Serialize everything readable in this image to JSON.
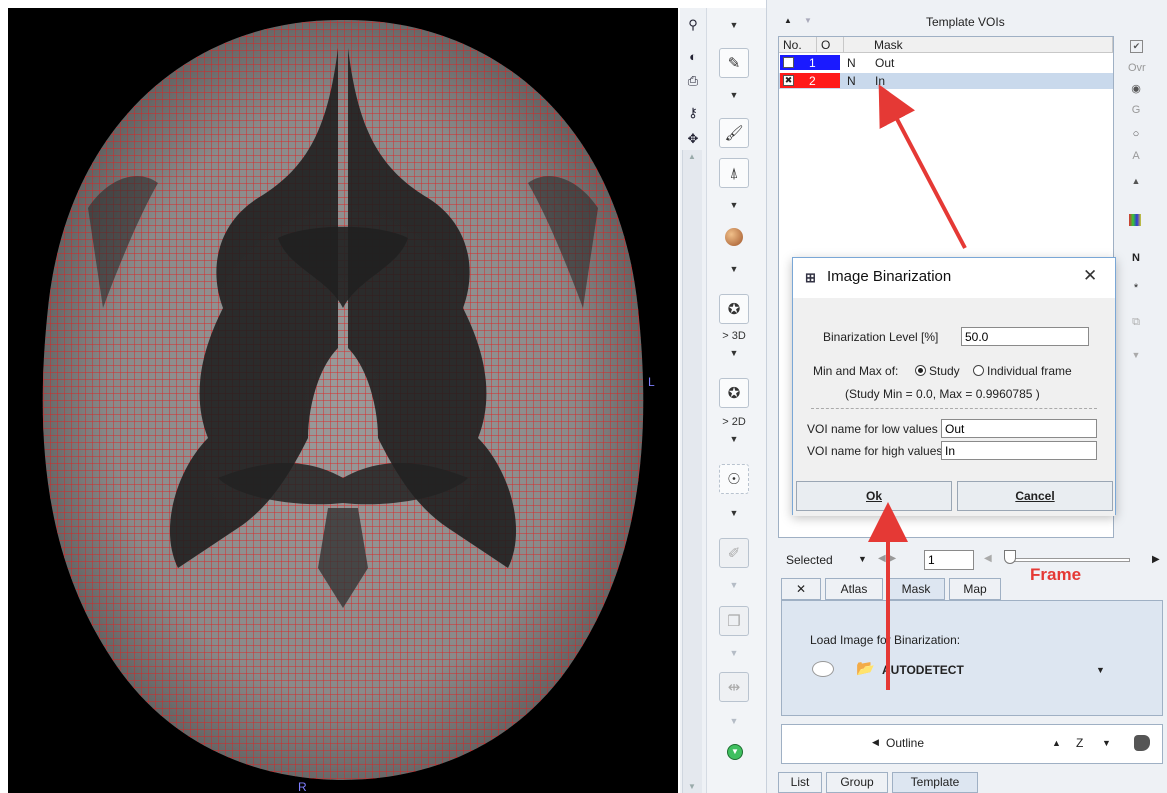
{
  "viewport": {
    "orientation_right": "L",
    "orientation_bottom": "R"
  },
  "toolbar": {
    "label_3d": "> 3D",
    "label_2d": "> 2D"
  },
  "voi_panel": {
    "header": "Template VOIs",
    "columns": [
      "No.",
      "O",
      "Mask"
    ],
    "rows": [
      {
        "no": "1",
        "o": "N",
        "name": "Out",
        "color": "#1a1aff",
        "selected": false
      },
      {
        "no": "2",
        "o": "N",
        "name": "In",
        "color": "#ff1a1a",
        "selected": true
      }
    ],
    "side_labels": {
      "ovr": "Ovr",
      "g": "G",
      "a": "A",
      "n": "N",
      "star": "*"
    }
  },
  "dialog": {
    "title": "Image Binarization",
    "close": "✕",
    "level_label": "Binarization Level [%]",
    "level_value": "50.0",
    "minmax_label": "Min and Max of:",
    "radio_study": "Study",
    "radio_frame": "Individual frame",
    "study_info": "(Study Min = 0.0, Max = 0.9960785 )",
    "low_label": "VOI name for low values",
    "low_value": "Out",
    "high_label": "VOI name for high values",
    "high_value": "In",
    "ok": "Ok",
    "cancel": "Cancel"
  },
  "frame_controls": {
    "selected": "Selected",
    "frame_value": "1"
  },
  "annotation": {
    "frame": "Frame"
  },
  "tabs": [
    "✕",
    "Atlas",
    "Mask",
    "Map"
  ],
  "active_tab": "Mask",
  "mask_panel": {
    "load_label": "Load Image for Binarization:",
    "source": "AUTODETECT"
  },
  "outline_bar": {
    "outline": "Outline",
    "axis": "Z"
  },
  "bottom_tabs": [
    "List",
    "Group",
    "Template"
  ],
  "colors": {
    "grid": "#e02020",
    "voi_out": "#1a1aff",
    "voi_in": "#ff1a1a",
    "arrow": "#e53935"
  }
}
